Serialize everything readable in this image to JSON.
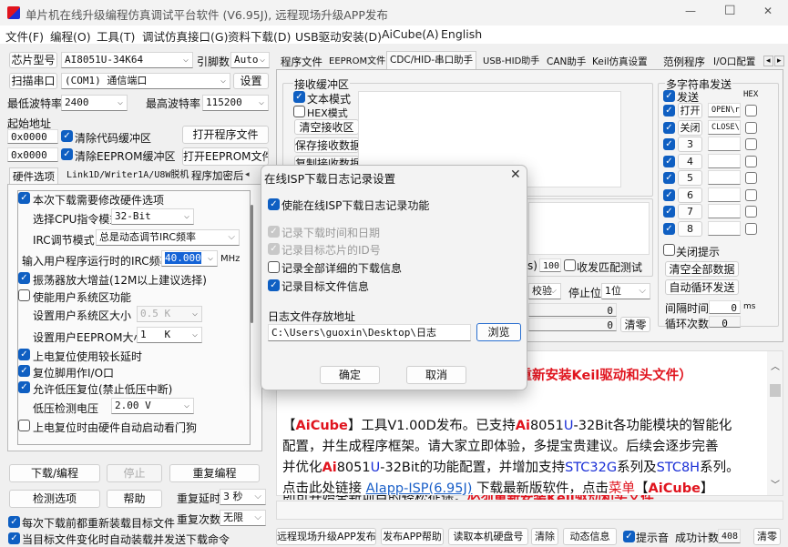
{
  "window": {
    "title": "单片机在线升级编程仿真调试平台软件 (V6.95J), 远程现场升级APP发布",
    "minimize": "—",
    "maximize": "☐",
    "close": "✕"
  },
  "menu": [
    "文件(F)",
    "编程(O)",
    "工具(T)",
    "调试仿真接口(G)",
    "资料下载(D)",
    "USB驱动安装(D)",
    "AiCube(A)",
    "English"
  ],
  "left": {
    "chip_btn": "芯片型号",
    "chip_value": "AI8051U-34K64",
    "pins_label": "引脚数",
    "pins_value": "Auto",
    "scan_btn": "扫描串口",
    "port_value": "(COM1) 通信端口",
    "settings_btn": "设置",
    "min_baud_label": "最低波特率",
    "min_baud": "2400",
    "max_baud_label": "最高波特率",
    "max_baud": "115200",
    "start_addr_label": "起始地址",
    "addr1": "0x0000",
    "clear_code": "清除代码缓冲区",
    "open_prog": "打开程序文件",
    "addr2": "0x0000",
    "clear_eeprom": "清除EEPROM缓冲区",
    "open_eeprom": "打开EEPROM文件",
    "tabs": [
      "硬件选项",
      "Link1D/Writer1A/U8W脱机",
      "程序加密后"
    ],
    "hw": {
      "modify_opts": "本次下载需要修改硬件选项",
      "cpu_mode_label": "选择CPU指令模式",
      "cpu_mode": "32-Bit",
      "irc_mode_label": "IRC调节模式",
      "irc_mode": "总是动态调节IRC频率",
      "irc_freq_label": "输入用户程序运行时的IRC频率",
      "irc_freq": "40.000",
      "irc_unit": "MHz",
      "osc_gain": "振荡器放大增益(12M以上建议选择)",
      "user_sys": "使能用户系统区功能",
      "sys_size_label": "设置用户系统区大小",
      "sys_size": "0.5 K",
      "eeprom_size_label": "设置用户EEPROM大小",
      "eeprom_size": "1   K",
      "long_delay": "上电复位使用较长延时",
      "reset_io": "复位脚用作I/O口",
      "lvr": "允许低压复位(禁止低压中断)",
      "lvd_label": "低压检测电压",
      "lvd": "2.00 V",
      "wdt": "上电复位时由硬件自动启动看门狗"
    },
    "download": "下载/编程",
    "stop": "停止",
    "repeat": "重复编程",
    "check": "检测选项",
    "help": "帮助",
    "delay_label": "重复延时",
    "delay": "3 秒",
    "count_label": "重复次数",
    "count": "无限",
    "reload": "每次下载前都重新装载目标文件",
    "auto_send": "当目标文件变化时自动装载并发送下载命令"
  },
  "right": {
    "tabs": [
      "程序文件",
      "EEPROM文件",
      "CDC/HID-串口助手",
      "USB-HID助手",
      "CAN助手",
      "Keil仿真设置",
      "范例程序",
      "I/O口配置"
    ],
    "recv_group": "接收缓冲区",
    "text_mode": "文本模式",
    "hex_mode": "HEX模式",
    "clear_recv": "清空接收区",
    "save_recv": "保存接收数据",
    "copy_recv": "复制接收数据",
    "interval_suffix": "s)",
    "interval": "100",
    "match_test": "收发匹配测试",
    "parity_partial": "校验",
    "stop_label": "停止位",
    "stop_bits": "1位",
    "cnt1": "0",
    "cnt2": "0",
    "clear_cnt": "清零",
    "multi": {
      "title": "多字符串发送",
      "send": "发送",
      "hex": "HEX",
      "rows": [
        {
          "label": "打开",
          "value": "OPEN\\r"
        },
        {
          "label": "关闭",
          "value": "CLOSE\\"
        },
        {
          "label": "3",
          "value": ""
        },
        {
          "label": "4",
          "value": ""
        },
        {
          "label": "5",
          "value": ""
        },
        {
          "label": "6",
          "value": ""
        },
        {
          "label": "7",
          "value": ""
        },
        {
          "label": "8",
          "value": ""
        }
      ],
      "close_tip": "关闭提示",
      "clear_all": "清空全部数据",
      "auto_loop": "自动循环发送",
      "interval_label": "间隔时间",
      "interval": "0",
      "ms": "ms",
      "loop_label": "循环次数",
      "loop": "0"
    },
    "info": {
      "l0": "须重新安装Keil驱动和头文件）",
      "l1": [
        [
          "【",
          ""
        ],
        [
          "AiCube",
          "red"
        ],
        [
          "】工具V1.00D发布。已支持",
          ""
        ],
        [
          "Ai",
          "red"
        ],
        [
          "8051",
          ""
        ],
        [
          "U",
          "blue"
        ],
        [
          "-32Bit各功能模块的智能化",
          ""
        ]
      ],
      "l2": "配置，并生成程序框架。请大家立即体验，多提宝贵建议。后续会逐步完善",
      "l3": [
        [
          "并优化",
          ""
        ],
        [
          "Ai",
          "red"
        ],
        [
          "8051",
          ""
        ],
        [
          "U",
          "blue"
        ],
        [
          "-32Bit的功能配置，并增加支持",
          ""
        ],
        [
          "STC32G",
          "blue"
        ],
        [
          "系列及",
          ""
        ],
        [
          "STC8H",
          "blue"
        ],
        [
          "系列。",
          ""
        ]
      ],
      "l4": [
        [
          "点击此处链接 ",
          ""
        ],
        [
          "AIapp-ISP(6.95J)",
          "link"
        ],
        [
          " 下载最新版软件，点击",
          ""
        ],
        [
          "菜单",
          "redb"
        ],
        [
          "【",
          ""
        ],
        [
          "AiCube",
          "red"
        ],
        [
          "】",
          ""
        ]
      ],
      "l5": [
        [
          "即可开始全新项目的轻松征途。",
          ""
        ],
        [
          "必须重新安装Keil驱动和头文件",
          "red"
        ]
      ]
    },
    "bottom": {
      "publish": "远程现场升级APP发布",
      "publish_help": "发布APP帮助",
      "read_disk": "读取本机硬盘号",
      "clear": "清除",
      "dyn_info": "动态信息",
      "beep": "提示音",
      "success_label": "成功计数",
      "success": "408",
      "reset": "清零"
    }
  },
  "dialog": {
    "title": "在线ISP下载日志记录设置",
    "enable": "使能在线ISP下载日志记录功能",
    "rec_time": "记录下载时间和日期",
    "rec_id": "记录目标芯片的ID号",
    "rec_all": "记录全部详细的下载信息",
    "rec_file": "记录目标文件信息",
    "path_label": "日志文件存放地址",
    "path": "C:\\Users\\guoxin\\Desktop\\日志",
    "browse": "浏览",
    "ok": "确定",
    "cancel": "取消"
  }
}
